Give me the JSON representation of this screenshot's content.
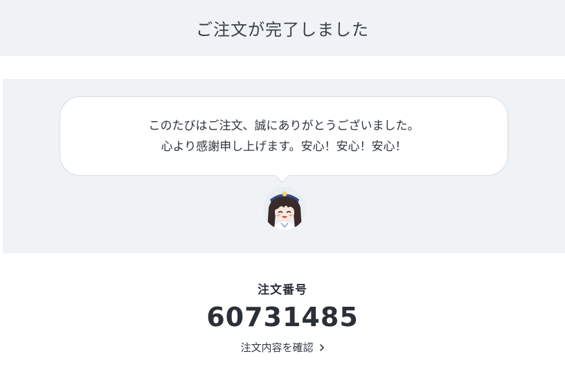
{
  "header": {
    "title": "ご注文が完了しました"
  },
  "message": {
    "line1": "このたびはご注文、誠にありがとうございました。",
    "line2": "心より感謝申し上げます。安心！安心！安心！"
  },
  "mascot": {
    "icon": "mascot-avatar"
  },
  "order": {
    "label": "注文番号",
    "number": "60731485",
    "details_link": "注文内容を確認",
    "link_icon": "chevron-right-icon"
  }
}
